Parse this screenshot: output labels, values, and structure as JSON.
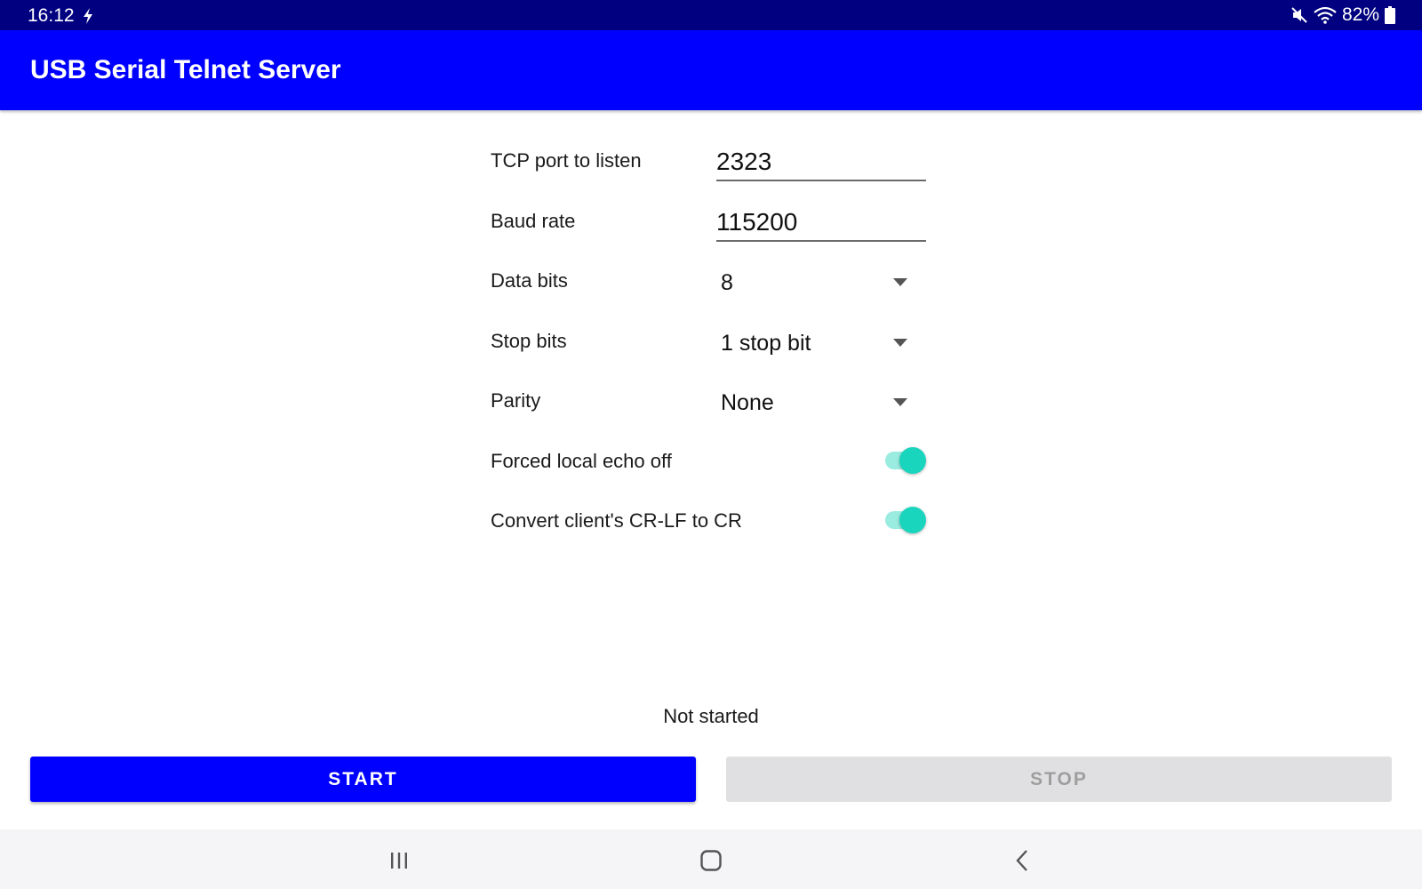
{
  "status_bar": {
    "time": "16:12",
    "battery": "82%",
    "icons": [
      "charging-icon",
      "mute-icon",
      "wifi-icon",
      "battery-icon"
    ]
  },
  "app": {
    "title": "USB Serial Telnet Server"
  },
  "form": {
    "tcp_port": {
      "label": "TCP port to listen",
      "value": "2323"
    },
    "baud_rate": {
      "label": "Baud rate",
      "value": "115200"
    },
    "data_bits": {
      "label": "Data bits",
      "value": "8"
    },
    "stop_bits": {
      "label": "Stop bits",
      "value": "1 stop bit"
    },
    "parity": {
      "label": "Parity",
      "value": "None"
    },
    "local_echo": {
      "label": "Forced local echo off",
      "on": true
    },
    "crlf": {
      "label": "Convert client's CR-LF to CR",
      "on": true
    }
  },
  "status_text": "Not started",
  "buttons": {
    "start": "START",
    "stop": "STOP"
  },
  "nav": {
    "icons": [
      "recent-apps-icon",
      "home-icon",
      "back-icon"
    ]
  },
  "colors": {
    "status_bar": "#000080",
    "app_bar": "#0000ff",
    "accent": "#1ad5bd",
    "button_primary": "#0000ff",
    "button_disabled": "#e0e0e2"
  }
}
